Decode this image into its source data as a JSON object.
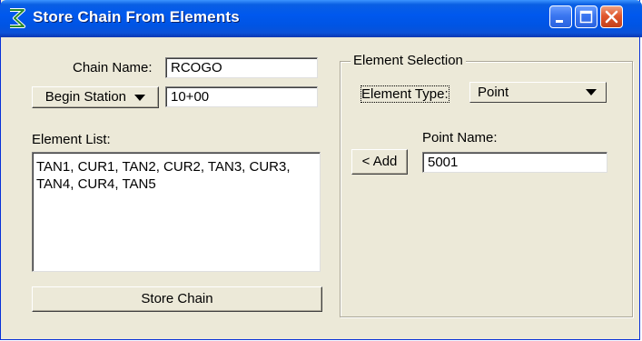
{
  "window": {
    "title": "Store Chain From Elements",
    "controls": [
      "minimize-icon",
      "maximize-icon",
      "close-icon"
    ]
  },
  "chain": {
    "name_label": "Chain Name:",
    "name_value": "RCOGO",
    "begin_station_label": "Begin Station",
    "begin_station_value": "10+00",
    "element_list_label": "Element List:",
    "element_list_text": "TAN1,  CUR1, TAN2, CUR2, TAN3, CUR3, TAN4, CUR4, TAN5",
    "store_button_label": "Store Chain"
  },
  "element_selection": {
    "group_title": "Element Selection",
    "element_type_label": "Element Type:",
    "element_type_value": "Point",
    "point_name_label": "Point Name:",
    "point_name_value": "5001",
    "add_button_label": "< Add"
  },
  "colors": {
    "titlebar": "#0054e3",
    "face": "#ece9d8",
    "close_button": "#e0582e"
  }
}
